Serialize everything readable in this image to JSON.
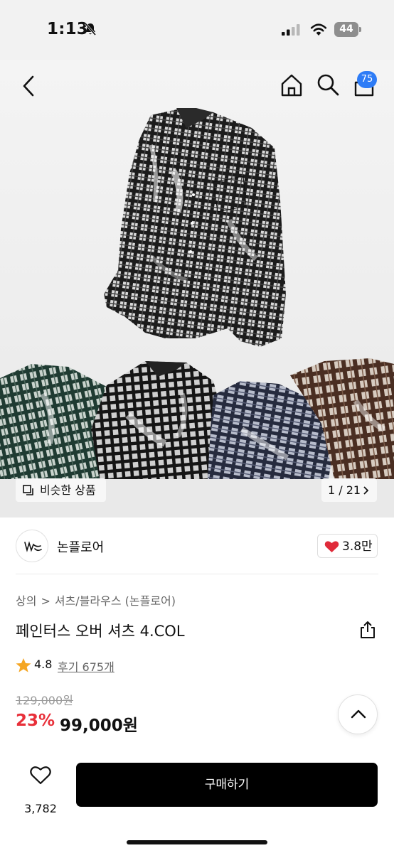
{
  "status_bar": {
    "time": "1:13",
    "battery": "44"
  },
  "header": {
    "cart_badge": "75"
  },
  "gallery": {
    "similar_label": "비슷한 상품",
    "counter": "1 / 21"
  },
  "brand": {
    "name": "논플로어",
    "likes": "3.8만"
  },
  "product": {
    "breadcrumb": [
      "상의",
      "셔츠/블라우스 (논플로어)"
    ],
    "breadcrumb_separator": ">",
    "title": "페인터스 오버 셔츠 4.COL",
    "rating": "4.8",
    "reviews": "후기 675개",
    "original_price": "129,000원",
    "discount_rate": "23%",
    "sale_price": "99,000원"
  },
  "bottom_bar": {
    "wish_count": "3,782",
    "buy_label": "구매하기"
  },
  "colors": {
    "accent_blue": "#2e7cf6",
    "discount_red": "#e8303a",
    "heart_red": "#e02b3a",
    "star_orange": "#f5a623",
    "buy_button": "#000000"
  },
  "icons": [
    "bell-slash-icon",
    "signal-icon",
    "wifi-icon",
    "battery-icon",
    "back-icon",
    "home-icon",
    "search-icon",
    "cart-icon",
    "similar-icon",
    "chevron-right-icon",
    "heart-icon",
    "share-icon",
    "star-icon",
    "chevron-up-icon",
    "heart-outline-icon"
  ]
}
